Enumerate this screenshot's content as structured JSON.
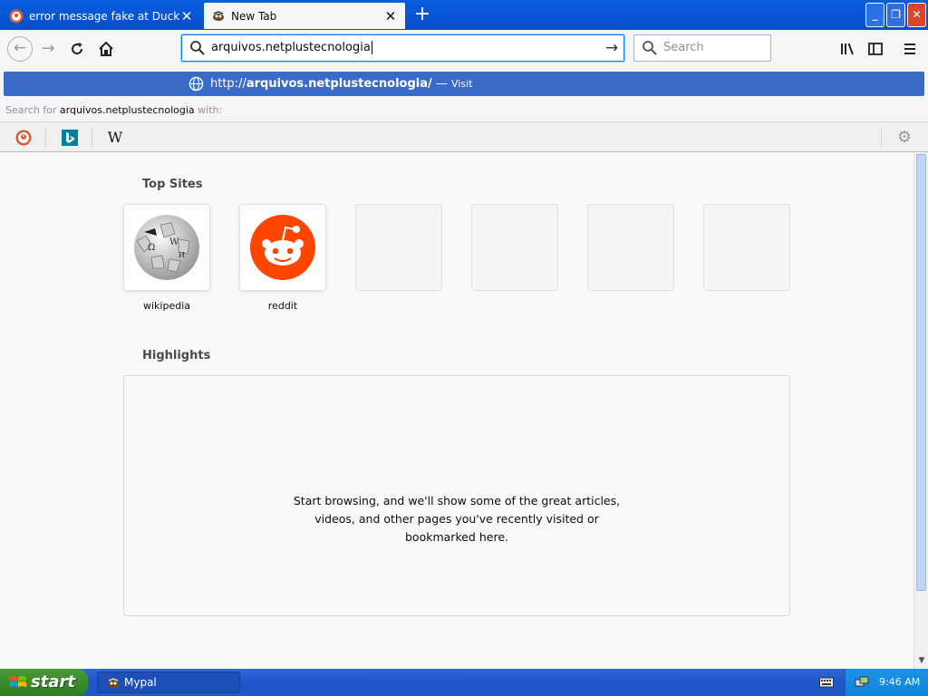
{
  "browser": {
    "tabs": [
      {
        "label": "error message fake at DuckDuckGo",
        "active": false
      },
      {
        "label": "New Tab",
        "active": true
      }
    ],
    "url_input": "arquivos.netplustecnologia",
    "search_placeholder": "Search"
  },
  "autocomplete": {
    "visit_prefix": "http://",
    "visit_domain": "arquivos.netplustecnologia/",
    "visit_sep": " — ",
    "visit_action": "Visit",
    "search_for_label": "Search for",
    "search_for_query": "arquivos.netplustecnologia",
    "search_for_suffix": "with:"
  },
  "newtab": {
    "top_sites_title": "Top Sites",
    "top_sites": [
      {
        "label": "wikipedia",
        "icon": "wikipedia-globe-icon"
      },
      {
        "label": "reddit",
        "icon": "reddit-alien-icon"
      }
    ],
    "highlights_title": "Highlights",
    "highlights_lines": [
      "Start browsing, and we'll show some of the great articles,",
      "videos, and other pages you've recently visited or",
      "bookmarked here."
    ]
  },
  "taskbar": {
    "start_label": "start",
    "task_label": "Mypal",
    "clock": "9:46 AM"
  },
  "colors": {
    "accent": "#0a84ff",
    "visit_row": "#3a6bc8",
    "reddit": "#ff4500",
    "xp_taskbar": "#245edb",
    "xp_start": "#3c8c2d"
  }
}
